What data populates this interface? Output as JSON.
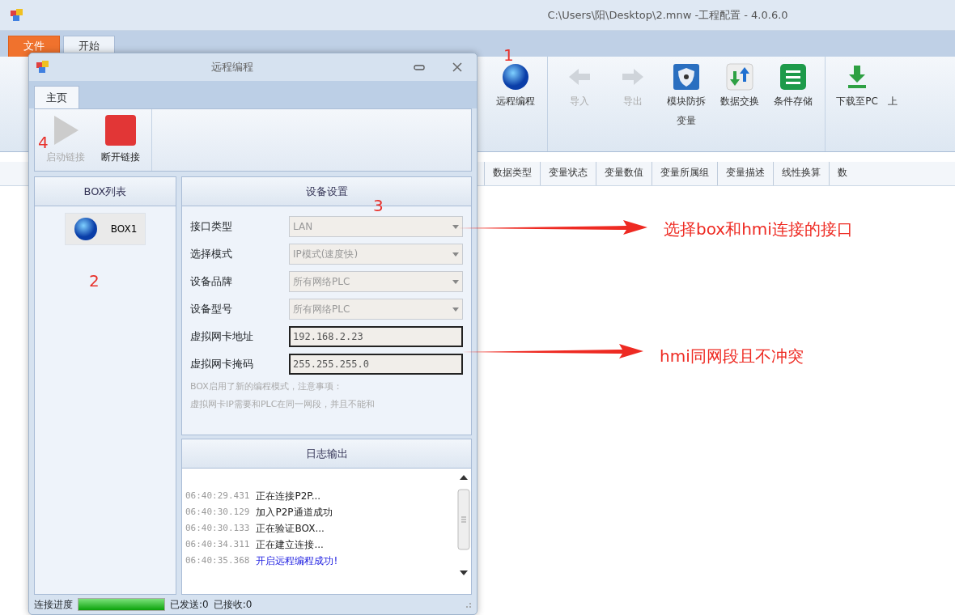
{
  "main_window": {
    "title": "C:\\Users\\阳\\Desktop\\2.mnw -工程配置 - 4.0.6.0",
    "tabs": [
      {
        "label": "文件",
        "selected": true
      },
      {
        "label": "开始",
        "selected": false
      }
    ],
    "ribbon_groups": [
      {
        "items": [
          {
            "label": "远程编程",
            "kind": "globe",
            "disabled": false
          }
        ]
      },
      {
        "label": "变量",
        "items": [
          {
            "label": "导入",
            "kind": "left",
            "disabled": true
          },
          {
            "label": "导出",
            "kind": "right",
            "disabled": true
          },
          {
            "label": "模块防拆",
            "kind": "shield",
            "disabled": false
          },
          {
            "label": "数据交换",
            "kind": "exchange",
            "disabled": false
          },
          {
            "label": "条件存储",
            "kind": "list",
            "disabled": false
          }
        ]
      },
      {
        "items": [
          {
            "label": "下载至PC",
            "kind": "download",
            "disabled": false
          },
          {
            "label": "上",
            "kind": "text",
            "disabled": false
          }
        ]
      }
    ],
    "columns": [
      "数据类型",
      "变量状态",
      "变量数值",
      "变量所属组",
      "变量描述",
      "线性换算",
      "数"
    ]
  },
  "dialog": {
    "title": "远程编程",
    "tabs": [
      {
        "label": "主页",
        "selected": true
      }
    ],
    "toolbar": [
      {
        "label": "启动链接",
        "kind": "play",
        "disabled": true
      },
      {
        "label": "断开链接",
        "kind": "stop",
        "disabled": false
      }
    ],
    "box_list": {
      "header": "BOX列表",
      "items": [
        {
          "label": "BOX1"
        }
      ]
    },
    "device_settings": {
      "header": "设备设置",
      "fields": [
        {
          "label": "接口类型",
          "kind": "select",
          "value": "LAN",
          "disabled": true
        },
        {
          "label": "选择模式",
          "kind": "select",
          "value": "IP模式(速度快)",
          "disabled": true
        },
        {
          "label": "设备品牌",
          "kind": "select",
          "value": "所有网络PLC",
          "disabled": true
        },
        {
          "label": "设备型号",
          "kind": "select",
          "value": "所有网络PLC",
          "disabled": true
        },
        {
          "label": "虚拟网卡地址",
          "kind": "input",
          "value": "192.168.2.23",
          "disabled": false
        },
        {
          "label": "虚拟网卡掩码",
          "kind": "input",
          "value": "255.255.255.0",
          "disabled": false
        }
      ],
      "note": [
        "BOX启用了新的编程模式，注意事项：",
        "虚拟网卡IP需要和PLC在同一网段，并且不能和"
      ]
    },
    "log": {
      "header": "日志输出",
      "entries": [
        {
          "time": "06:40:29.431",
          "message": "正在连接P2P...",
          "kind": "info"
        },
        {
          "time": "06:40:30.129",
          "message": "加入P2P通道成功",
          "kind": "info"
        },
        {
          "time": "06:40:30.133",
          "message": "正在验证BOX...",
          "kind": "info"
        },
        {
          "time": "06:40:34.311",
          "message": "正在建立连接...",
          "kind": "info"
        },
        {
          "time": "06:40:35.368",
          "message": "开启远程编程成功!",
          "kind": "success"
        }
      ]
    },
    "status": {
      "label": "连接进度",
      "level": 1,
      "sent": "已发送:0",
      "received": "已接收:0"
    }
  },
  "annotations": {
    "markers": [
      "1",
      "2",
      "3",
      "4"
    ],
    "callouts": [
      "选择box和hmi连接的接口",
      "hmi同网段且不冲突"
    ]
  }
}
